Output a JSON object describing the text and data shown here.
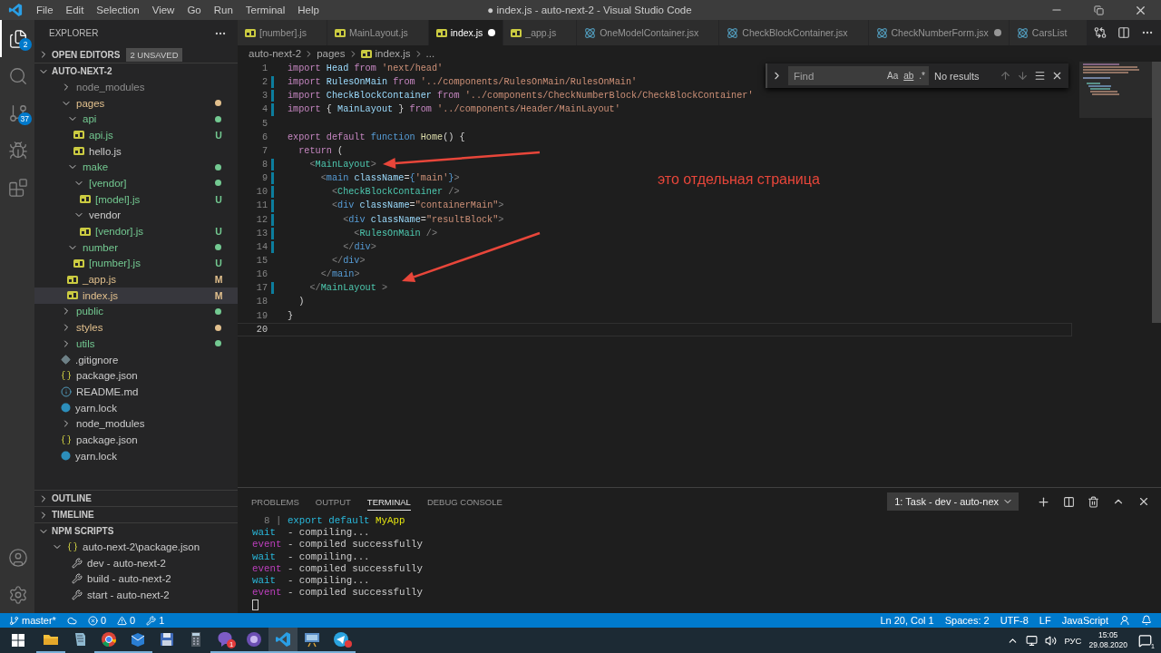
{
  "window": {
    "title": "● index.js - auto-next-2 - Visual Studio Code"
  },
  "menu": [
    "File",
    "Edit",
    "Selection",
    "View",
    "Go",
    "Run",
    "Terminal",
    "Help"
  ],
  "activity_bar": {
    "items": [
      {
        "kind": "files",
        "selected": true,
        "badge": "2"
      },
      {
        "kind": "search",
        "selected": false
      },
      {
        "kind": "source_control",
        "selected": false,
        "badge": "37"
      },
      {
        "kind": "debug",
        "selected": false
      },
      {
        "kind": "extensions",
        "selected": false
      }
    ],
    "bottom": [
      {
        "kind": "account"
      },
      {
        "kind": "settings"
      }
    ]
  },
  "sidebar": {
    "title": "EXPLORER",
    "open_editors": {
      "label": "OPEN EDITORS",
      "badge": "2 UNSAVED",
      "expanded": false
    },
    "folder": {
      "label": "AUTO-NEXT-2",
      "expanded": true
    },
    "tree": [
      {
        "label": "node_modules",
        "kind": "folder",
        "color": "#8c8c8c",
        "expanded": false,
        "dot": false,
        "selected": false
      },
      {
        "label": "pages",
        "kind": "folder",
        "color": "#e2c08d",
        "expanded": true,
        "dot": true,
        "selected": false,
        "children": [
          {
            "label": "api",
            "kind": "folder",
            "color": "#73c991",
            "expanded": true,
            "dot": true,
            "selected": false,
            "children": [
              {
                "label": "api.js",
                "kind": "js",
                "color": "#73c991",
                "badge": "U",
                "dot": false,
                "selected": false
              },
              {
                "label": "hello.js",
                "kind": "js",
                "color": "#cccccc",
                "dot": false,
                "selected": false
              }
            ]
          },
          {
            "label": "make",
            "kind": "folder",
            "color": "#73c991",
            "expanded": true,
            "dot": true,
            "selected": false,
            "children": [
              {
                "label": "[vendor]",
                "kind": "folder",
                "color": "#73c991",
                "expanded": true,
                "dot": true,
                "selected": false,
                "children": [
                  {
                    "label": "[model].js",
                    "kind": "js",
                    "color": "#73c991",
                    "badge": "U",
                    "dot": false,
                    "selected": false
                  }
                ]
              },
              {
                "label": "vendor",
                "kind": "folder",
                "color": "#cccccc",
                "expanded": true,
                "dot": false,
                "selected": false,
                "children": [
                  {
                    "label": "[vendor].js",
                    "kind": "js",
                    "color": "#73c991",
                    "badge": "U",
                    "dot": false,
                    "selected": false
                  }
                ]
              }
            ]
          },
          {
            "label": "number",
            "kind": "folder",
            "color": "#73c991",
            "expanded": true,
            "dot": true,
            "selected": false,
            "children": [
              {
                "label": "[number].js",
                "kind": "js",
                "color": "#73c991",
                "badge": "U",
                "dot": false,
                "selected": false
              }
            ]
          },
          {
            "label": "_app.js",
            "kind": "js",
            "color": "#e2c08d",
            "badge": "M",
            "dot": false,
            "selected": false
          },
          {
            "label": "index.js",
            "kind": "js",
            "color": "#e2c08d",
            "badge": "M",
            "dot": false,
            "selected": true
          }
        ]
      },
      {
        "label": "public",
        "kind": "folder",
        "color": "#73c991",
        "expanded": false,
        "dot": true,
        "selected": false
      },
      {
        "label": "styles",
        "kind": "folder",
        "color": "#e2c08d",
        "expanded": false,
        "dot": true,
        "selected": false
      },
      {
        "label": "utils",
        "kind": "folder",
        "color": "#73c991",
        "expanded": false,
        "dot": true,
        "selected": false
      },
      {
        "label": ".gitignore",
        "kind": "git",
        "color": "#cccccc",
        "dot": false,
        "selected": false
      },
      {
        "label": "package.json",
        "kind": "json",
        "color": "#cccccc",
        "dot": false,
        "selected": false
      },
      {
        "label": "README.md",
        "kind": "info",
        "color": "#cccccc",
        "dot": false,
        "selected": false
      },
      {
        "label": "yarn.lock",
        "kind": "yarn",
        "color": "#cccccc",
        "dot": false,
        "selected": false
      },
      {
        "label": "node_modules",
        "kind": "folder",
        "color": "#cccccc",
        "expanded": false,
        "dot": false,
        "selected": false
      },
      {
        "label": "package.json",
        "kind": "json",
        "color": "#cccccc",
        "dot": false,
        "selected": false
      },
      {
        "label": "yarn.lock",
        "kind": "yarn",
        "color": "#cccccc",
        "dot": false,
        "selected": false
      }
    ],
    "sections": [
      {
        "label": "OUTLINE",
        "expanded": false
      },
      {
        "label": "TIMELINE",
        "expanded": false
      },
      {
        "label": "NPM SCRIPTS",
        "expanded": true
      }
    ],
    "npm_scripts": {
      "label": "auto-next-2\\package.json",
      "expanded": true,
      "scripts": [
        "dev - auto-next-2",
        "build - auto-next-2",
        "start - auto-next-2"
      ]
    }
  },
  "tabs": [
    {
      "label": "[number].js",
      "kind": "js",
      "selected": false,
      "dirty": false
    },
    {
      "label": "MainLayout.js",
      "kind": "js",
      "selected": false,
      "dirty": false
    },
    {
      "label": "index.js",
      "kind": "js",
      "selected": true,
      "dirty": true
    },
    {
      "label": "_app.js",
      "kind": "js",
      "selected": false,
      "dirty": false
    },
    {
      "label": "OneModelContainer.jsx",
      "kind": "react",
      "selected": false,
      "dirty": false
    },
    {
      "label": "CheckBlockContainer.jsx",
      "kind": "react",
      "selected": false,
      "dirty": false
    },
    {
      "label": "CheckNumberForm.jsx",
      "kind": "react",
      "selected": false,
      "dirty": true
    },
    {
      "label": "CarsList",
      "kind": "react",
      "selected": false,
      "dirty": false
    }
  ],
  "breadcrumb": [
    "auto-next-2",
    "pages",
    "index.js",
    "..."
  ],
  "editor": {
    "lines": [
      {
        "num": "1",
        "modified": false,
        "current": false,
        "tokens": [
          {
            "text": "import ",
            "kind": "keyword"
          },
          {
            "text": "Head ",
            "kind": "variable"
          },
          {
            "text": "from ",
            "kind": "keyword"
          },
          {
            "text": "'next/head'",
            "kind": "string"
          }
        ]
      },
      {
        "num": "2",
        "modified": true,
        "current": false,
        "tokens": [
          {
            "text": "import ",
            "kind": "keyword"
          },
          {
            "text": "RulesOnMain ",
            "kind": "variable"
          },
          {
            "text": "from ",
            "kind": "keyword"
          },
          {
            "text": "'../components/RulesOnMain/RulesOnMain'",
            "kind": "string"
          }
        ]
      },
      {
        "num": "3",
        "modified": true,
        "current": false,
        "tokens": [
          {
            "text": "import ",
            "kind": "keyword"
          },
          {
            "text": "CheckBlockContainer ",
            "kind": "variable"
          },
          {
            "text": "from ",
            "kind": "keyword"
          },
          {
            "text": "'../components/CheckNumberBlock/CheckBlockContainer'",
            "kind": "string"
          }
        ]
      },
      {
        "num": "4",
        "modified": true,
        "current": false,
        "tokens": [
          {
            "text": "import ",
            "kind": "keyword"
          },
          {
            "text": "{ ",
            "kind": "plain"
          },
          {
            "text": "MainLayout ",
            "kind": "variable"
          },
          {
            "text": "} ",
            "kind": "plain"
          },
          {
            "text": "from ",
            "kind": "keyword"
          },
          {
            "text": "'../components/Header/MainLayout'",
            "kind": "string"
          }
        ]
      },
      {
        "num": "5",
        "modified": false,
        "current": false
      },
      {
        "num": "6",
        "modified": false,
        "current": false,
        "tokens": [
          {
            "text": "export default ",
            "kind": "keyword"
          },
          {
            "text": "function ",
            "kind": "declaration"
          },
          {
            "text": "Home",
            "kind": "function"
          },
          {
            "text": "() {",
            "kind": "plain"
          }
        ]
      },
      {
        "num": "7",
        "modified": false,
        "current": false,
        "tokens": [
          {
            "text": "  return ",
            "kind": "keyword"
          },
          {
            "text": "(",
            "kind": "plain"
          }
        ]
      },
      {
        "num": "8",
        "modified": true,
        "current": false,
        "tokens": [
          {
            "text": "    <",
            "kind": "punctuation"
          },
          {
            "text": "MainLayout",
            "kind": "component"
          },
          {
            "text": ">",
            "kind": "punctuation"
          }
        ]
      },
      {
        "num": "9",
        "modified": true,
        "current": false,
        "tokens": [
          {
            "text": "      <",
            "kind": "punctuation"
          },
          {
            "text": "main ",
            "kind": "tag"
          },
          {
            "text": "className",
            "kind": "attribute"
          },
          {
            "text": "=",
            "kind": "plain"
          },
          {
            "text": "{",
            "kind": "tag"
          },
          {
            "text": "'main'",
            "kind": "string"
          },
          {
            "text": "}",
            "kind": "tag"
          },
          {
            "text": ">",
            "kind": "punctuation"
          }
        ]
      },
      {
        "num": "10",
        "modified": true,
        "current": false,
        "tokens": [
          {
            "text": "        <",
            "kind": "punctuation"
          },
          {
            "text": "CheckBlockContainer ",
            "kind": "component"
          },
          {
            "text": "/>",
            "kind": "punctuation"
          }
        ]
      },
      {
        "num": "11",
        "modified": true,
        "current": false,
        "tokens": [
          {
            "text": "        <",
            "kind": "punctuation"
          },
          {
            "text": "div ",
            "kind": "tag"
          },
          {
            "text": "className",
            "kind": "attribute"
          },
          {
            "text": "=",
            "kind": "plain"
          },
          {
            "text": "\"containerMain\"",
            "kind": "string"
          },
          {
            "text": ">",
            "kind": "punctuation"
          }
        ]
      },
      {
        "num": "12",
        "modified": true,
        "current": false,
        "tokens": [
          {
            "text": "          <",
            "kind": "punctuation"
          },
          {
            "text": "div ",
            "kind": "tag"
          },
          {
            "text": "className",
            "kind": "attribute"
          },
          {
            "text": "=",
            "kind": "plain"
          },
          {
            "text": "\"resultBlock\"",
            "kind": "string"
          },
          {
            "text": ">",
            "kind": "punctuation"
          }
        ]
      },
      {
        "num": "13",
        "modified": true,
        "current": false,
        "tokens": [
          {
            "text": "            <",
            "kind": "punctuation"
          },
          {
            "text": "RulesOnMain ",
            "kind": "component"
          },
          {
            "text": "/>",
            "kind": "punctuation"
          }
        ]
      },
      {
        "num": "14",
        "modified": true,
        "current": false,
        "tokens": [
          {
            "text": "          </",
            "kind": "punctuation"
          },
          {
            "text": "div",
            "kind": "tag"
          },
          {
            "text": ">",
            "kind": "punctuation"
          }
        ]
      },
      {
        "num": "15",
        "modified": false,
        "current": false,
        "tokens": [
          {
            "text": "        </",
            "kind": "punctuation"
          },
          {
            "text": "div",
            "kind": "tag"
          },
          {
            "text": ">",
            "kind": "punctuation"
          }
        ]
      },
      {
        "num": "16",
        "modified": false,
        "current": false,
        "tokens": [
          {
            "text": "      </",
            "kind": "punctuation"
          },
          {
            "text": "main",
            "kind": "tag"
          },
          {
            "text": ">",
            "kind": "punctuation"
          }
        ]
      },
      {
        "num": "17",
        "modified": true,
        "current": false,
        "tokens": [
          {
            "text": "    </",
            "kind": "punctuation"
          },
          {
            "text": "MainLayout ",
            "kind": "component"
          },
          {
            "text": ">",
            "kind": "punctuation"
          }
        ]
      },
      {
        "num": "18",
        "modified": false,
        "current": false,
        "tokens": [
          {
            "text": "  )",
            "kind": "plain"
          }
        ]
      },
      {
        "num": "19",
        "modified": false,
        "current": false,
        "tokens": [
          {
            "text": "}",
            "kind": "plain"
          }
        ]
      },
      {
        "num": "20",
        "modified": false,
        "current": true
      }
    ],
    "find": {
      "placeholder": "Find",
      "toggles": [
        "Aa",
        "ab",
        ".*"
      ],
      "result": "No results"
    },
    "annotation": "это отдельная страница"
  },
  "panel": {
    "tabs": [
      {
        "label": "PROBLEMS",
        "selected": false
      },
      {
        "label": "OUTPUT",
        "selected": false
      },
      {
        "label": "TERMINAL",
        "selected": true
      },
      {
        "label": "DEBUG CONSOLE",
        "selected": false
      }
    ],
    "terminal_select": "1: Task - dev - auto-nex",
    "terminal": [
      [
        {
          "text": "  8 | ",
          "kind": "dim"
        },
        {
          "text": "export default ",
          "kind": "cyan"
        },
        {
          "text": "MyApp",
          "kind": "yellow"
        }
      ],
      [
        {
          "text": "wait",
          "kind": "cyan"
        },
        {
          "text": "  - compiling...",
          "kind": "plain"
        }
      ],
      [
        {
          "text": "event",
          "kind": "magenta"
        },
        {
          "text": " - compiled successfully",
          "kind": "plain"
        }
      ],
      [
        {
          "text": "wait",
          "kind": "cyan"
        },
        {
          "text": "  - compiling...",
          "kind": "plain"
        }
      ],
      [
        {
          "text": "event",
          "kind": "magenta"
        },
        {
          "text": " - compiled successfully",
          "kind": "plain"
        }
      ],
      [
        {
          "text": "wait",
          "kind": "cyan"
        },
        {
          "text": "  - compiling...",
          "kind": "plain"
        }
      ],
      [
        {
          "text": "event",
          "kind": "magenta"
        },
        {
          "text": " - compiled successfully",
          "kind": "plain"
        }
      ]
    ]
  },
  "status_bar": {
    "left": [
      {
        "kind": "branch",
        "text": "master*"
      },
      {
        "kind": "sync"
      },
      {
        "kind": "errors",
        "text": "0"
      },
      {
        "kind": "warnings",
        "text": "0"
      },
      {
        "kind": "tools",
        "text": "1"
      }
    ],
    "right": [
      {
        "kind": "text",
        "text": "Ln 20, Col 1"
      },
      {
        "kind": "text",
        "text": "Spaces: 2"
      },
      {
        "kind": "text",
        "text": "UTF-8"
      },
      {
        "kind": "text",
        "text": "LF"
      },
      {
        "kind": "text",
        "text": "JavaScript"
      },
      {
        "kind": "feedback"
      },
      {
        "kind": "bell"
      }
    ]
  },
  "taskbar": {
    "apps": [
      {
        "kind": "folder",
        "running": true,
        "active": false
      },
      {
        "kind": "notes",
        "running": false,
        "active": false
      },
      {
        "kind": "browser",
        "running": true,
        "active": false
      },
      {
        "kind": "mail",
        "running": true,
        "active": false
      },
      {
        "kind": "disk",
        "running": false,
        "active": false
      },
      {
        "kind": "calculator",
        "running": false,
        "active": false
      },
      {
        "kind": "messenger",
        "running": true,
        "active": false,
        "badge": "1"
      },
      {
        "kind": "torrent",
        "running": true,
        "active": false
      },
      {
        "kind": "code",
        "running": true,
        "active": true
      },
      {
        "kind": "screen",
        "running": true,
        "active": false
      },
      {
        "kind": "telegram",
        "running": true,
        "active": false,
        "alert": true
      }
    ],
    "lang": "РУС",
    "time": "15:05",
    "date": "29.08.2020",
    "notifications": "1"
  }
}
